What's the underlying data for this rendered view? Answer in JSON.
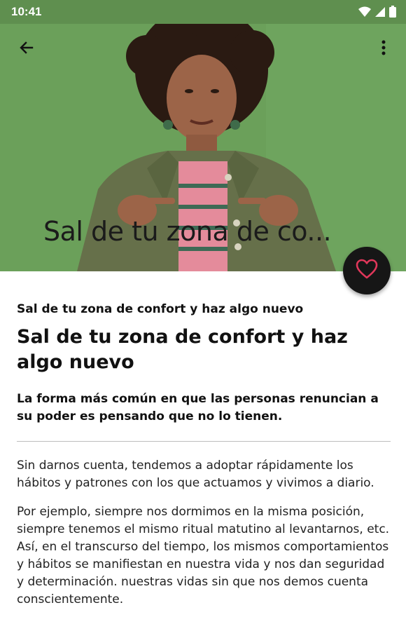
{
  "status_bar": {
    "time": "10:41"
  },
  "toolbar": {
    "back_icon": "arrow-back-icon",
    "more_icon": "more-vert-icon"
  },
  "hero": {
    "title_overlay": "Sal de tu zona de co..."
  },
  "favorite": {
    "icon": "heart-outline-icon",
    "color": "#e0375a"
  },
  "article": {
    "subtitle": "Sal de tu zona de confort y haz algo nuevo",
    "title": "Sal de tu zona de confort y haz algo nuevo",
    "lead": "La forma más común en que las personas renuncian a su poder es pensando que no lo tienen.",
    "paragraphs": [
      "Sin darnos cuenta, tendemos a adoptar rápidamente los hábitos y patrones con los que actuamos y vivimos a diario.",
      "Por ejemplo, siempre nos dormimos en la misma posición, siempre tenemos el mismo ritual matutino al levantarnos, etc. Así, en el transcurso del tiempo, los mismos comportamientos y hábitos se manifiestan en nuestra vida y nos dan seguridad y determinación. nuestras vidas sin que nos demos cuenta conscientemente."
    ]
  },
  "colors": {
    "hero_background": "#6ba05a",
    "fab_background": "#161616"
  }
}
